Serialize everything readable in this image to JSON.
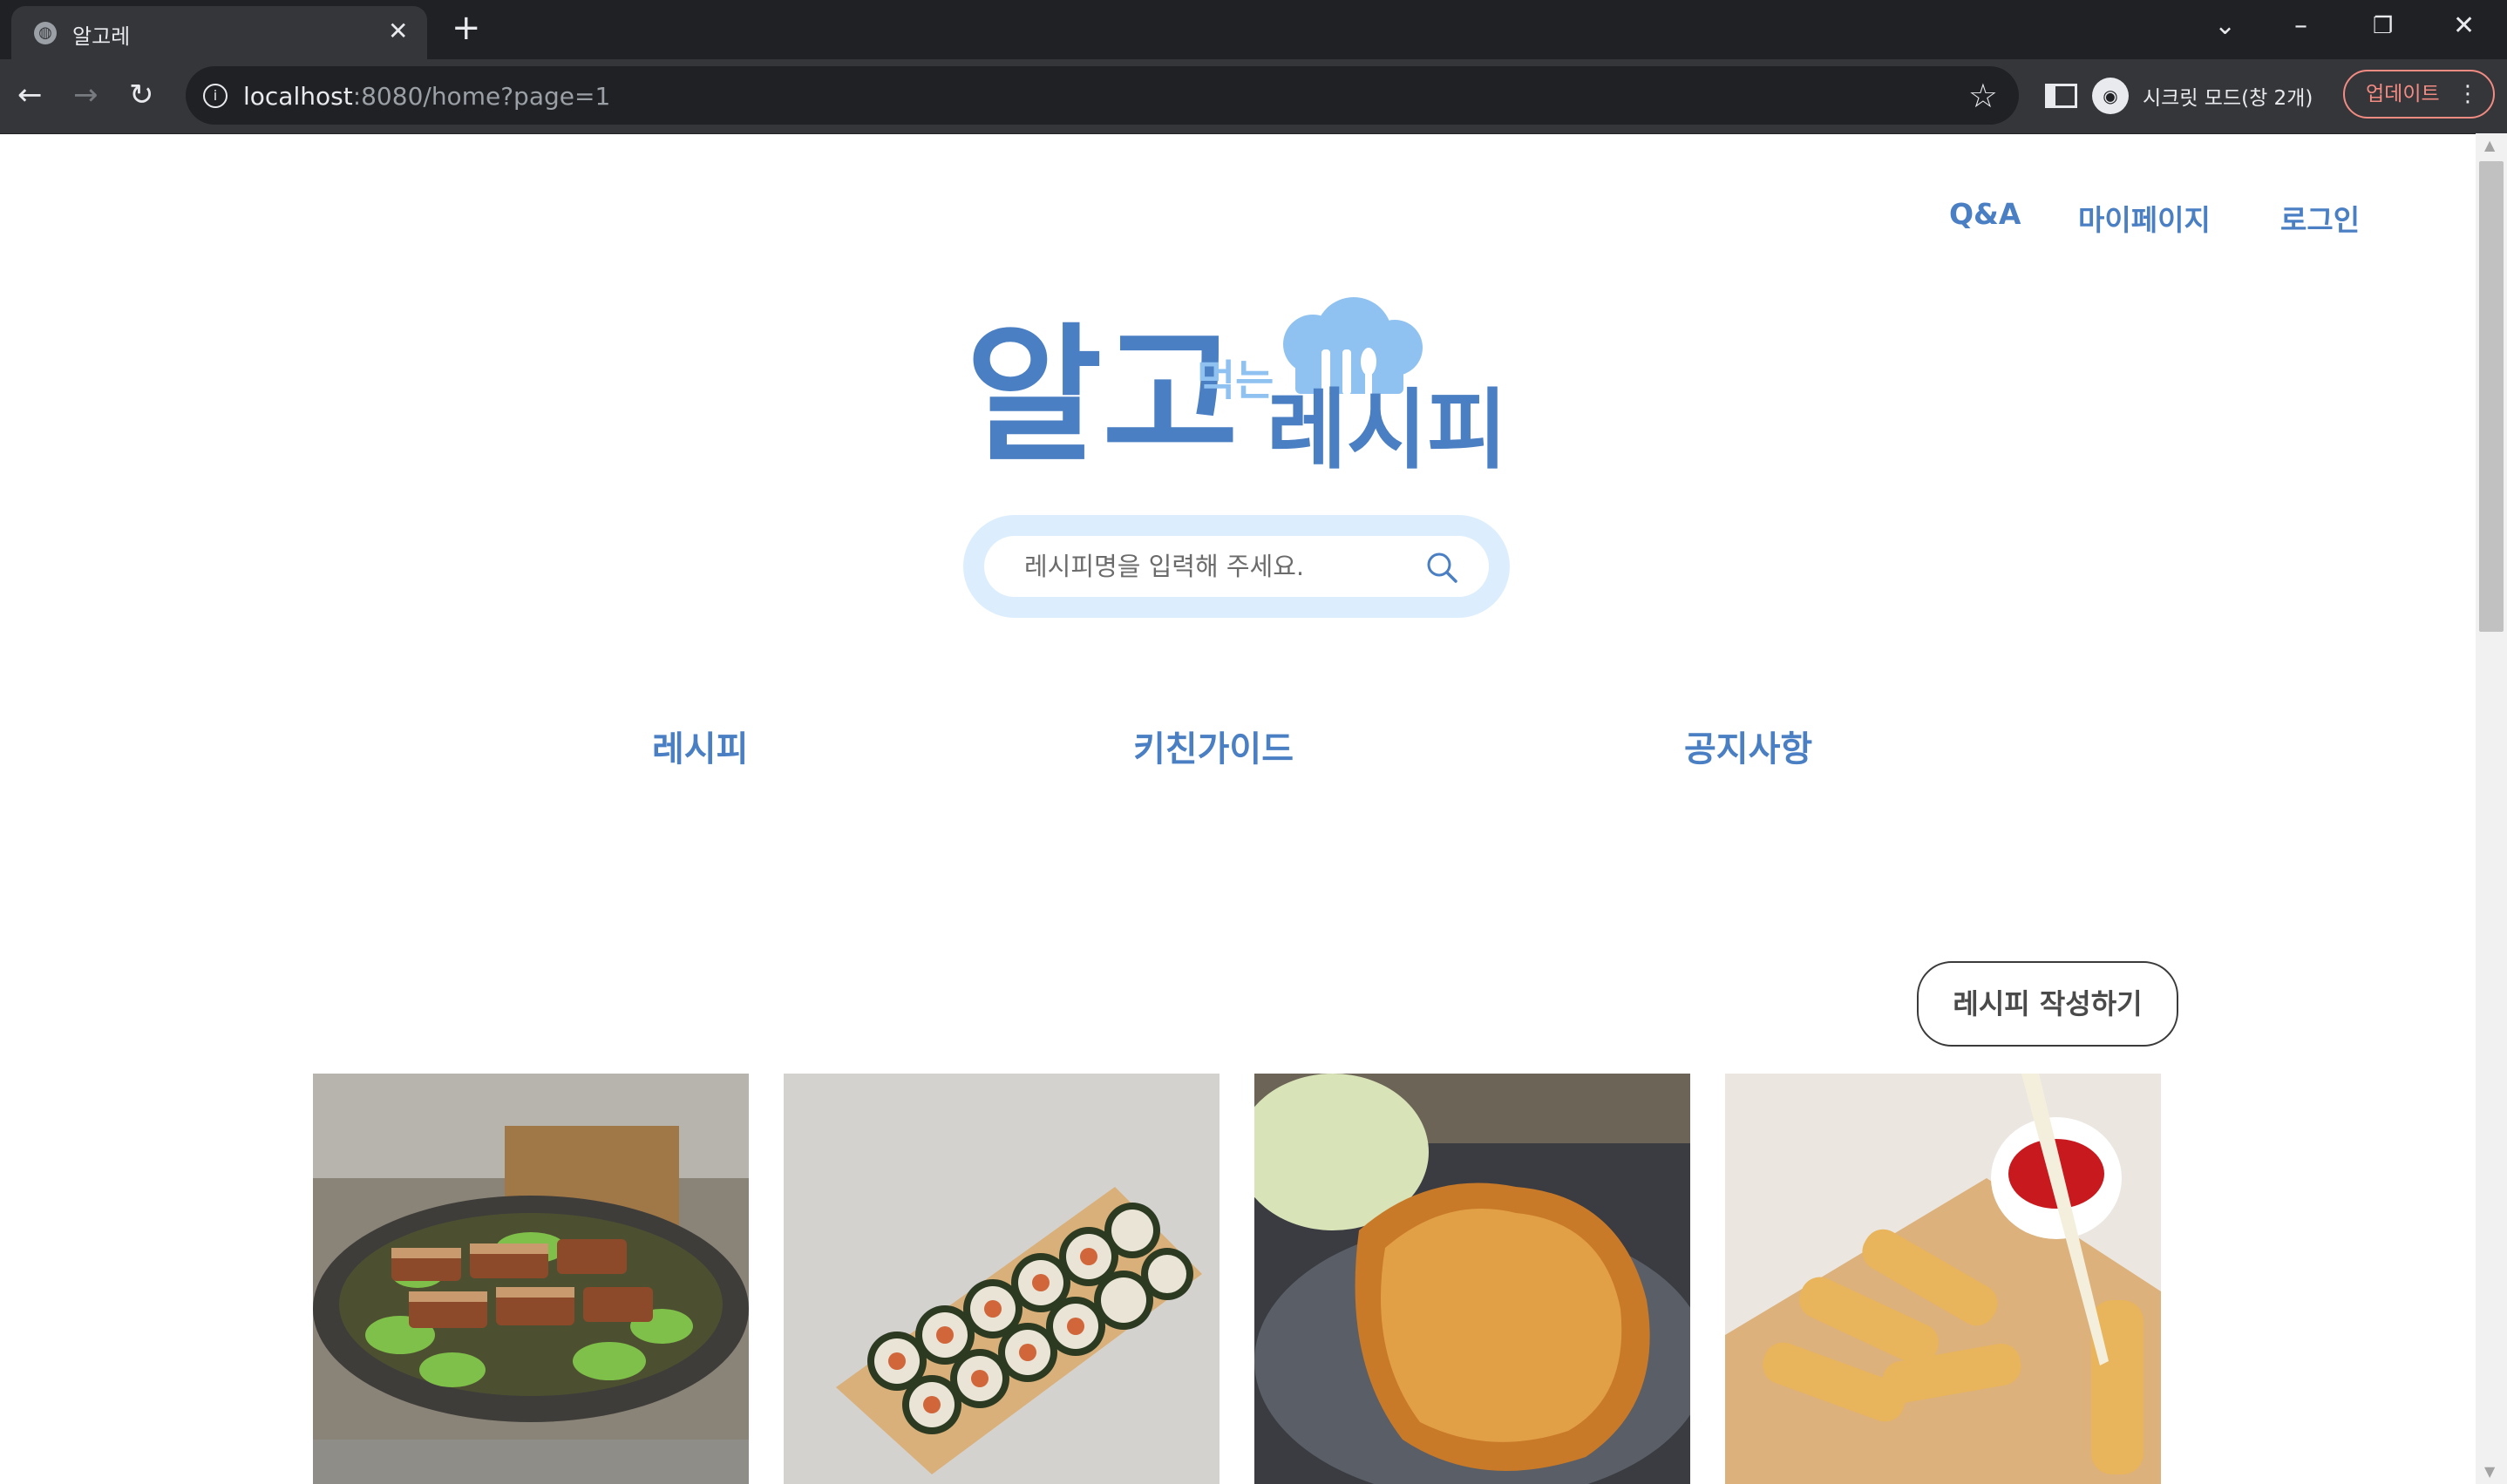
{
  "browser": {
    "tab_title": "알고레",
    "url_host": "localhost",
    "url_path": ":8080/home?page=1",
    "incognito_label": "시크릿 모드(창 2개)",
    "update_label": "업데이트"
  },
  "header": {
    "nav": [
      "Q&A",
      "마이페이지",
      "로그인"
    ]
  },
  "logo": {
    "line1": "알고",
    "small": "먹는",
    "line2": "레시피"
  },
  "search": {
    "placeholder": "레시피명을 입력해 주세요."
  },
  "menu": [
    "레시피",
    "키친가이드",
    "공지사항"
  ],
  "write_button": "레시피 작성하기",
  "colors": {
    "brand": "#4a7fc4",
    "logo_light": "#8fc2f0",
    "search_bg": "#dceefe"
  },
  "recipes": [
    {
      "image": "braised pork belly with bok choy"
    },
    {
      "image": "sliced kimbap on wooden board"
    },
    {
      "image": "fried pork cutlet"
    },
    {
      "image": "mozzarella cheese sticks with ketchup"
    }
  ]
}
